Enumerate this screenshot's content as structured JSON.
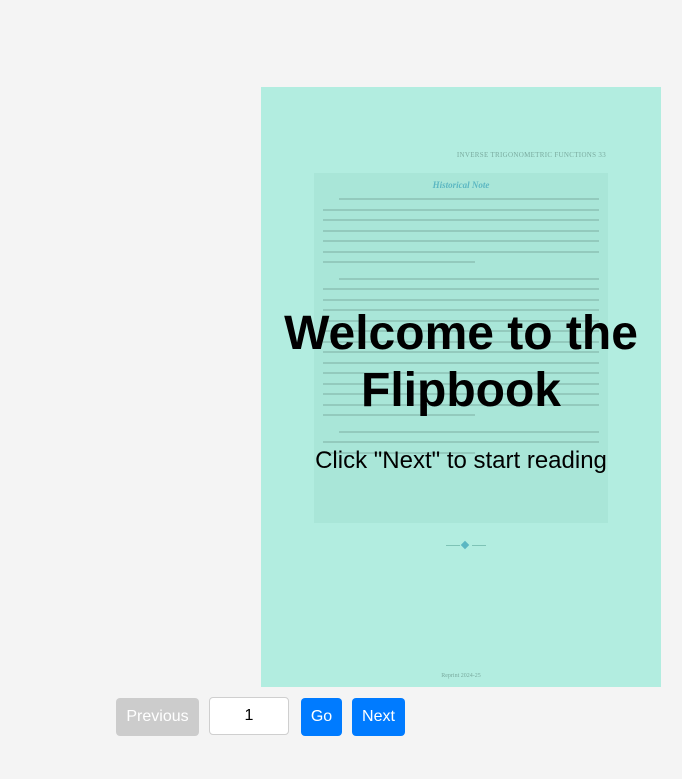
{
  "flipbook": {
    "page": {
      "running_head": "INVERSE TRIGONOMETRIC FUNCTIONS    33",
      "note_title": "Historical Note",
      "footer": "Reprint 2024-25"
    },
    "overlay": {
      "title": "Welcome to the Flipbook",
      "subtitle": "Click \"Next\" to start reading"
    }
  },
  "controls": {
    "previous_label": "Previous",
    "page_value": "1",
    "go_label": "Go",
    "next_label": "Next"
  },
  "colors": {
    "page_background": "#b2ede0",
    "primary_button": "#007bff",
    "disabled_button": "#cccccc"
  }
}
